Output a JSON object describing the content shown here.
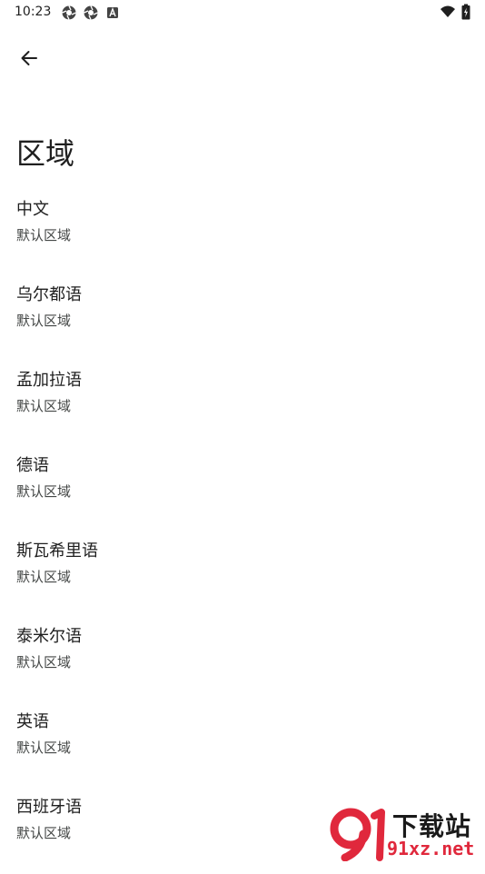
{
  "status_bar": {
    "time": "10:23",
    "left_icons": [
      "aperture-icon",
      "aperture-icon",
      "app-a-icon"
    ],
    "right_icons": [
      "wifi-icon",
      "battery-icon"
    ]
  },
  "header": {
    "back_icon": "arrow-left-icon",
    "title": "区域"
  },
  "regions": [
    {
      "name": "中文",
      "subtitle": "默认区域"
    },
    {
      "name": "乌尔都语",
      "subtitle": "默认区域"
    },
    {
      "name": "孟加拉语",
      "subtitle": "默认区域"
    },
    {
      "name": "德语",
      "subtitle": "默认区域"
    },
    {
      "name": "斯瓦希里语",
      "subtitle": "默认区域"
    },
    {
      "name": "泰米尔语",
      "subtitle": "默认区域"
    },
    {
      "name": "英语",
      "subtitle": "默认区域"
    },
    {
      "name": "西班牙语",
      "subtitle": "默认区域"
    }
  ],
  "watermark": {
    "top_text": "下载站",
    "bottom_text": "91xz.net",
    "accent": "#e0283c"
  }
}
